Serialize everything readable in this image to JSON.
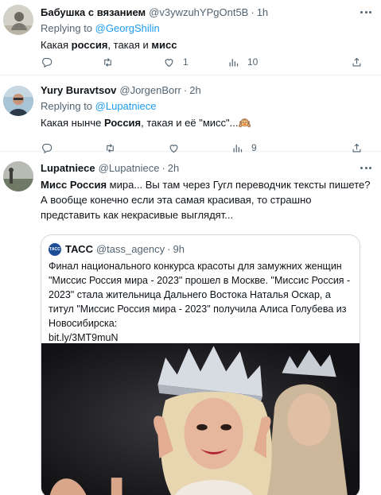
{
  "tweets": [
    {
      "name": "Бабушка с вязанием",
      "handle": "@v3ywzuhYPgOnt5B",
      "dot": "·",
      "time": "1h",
      "replying_prefix": "Replying to ",
      "replying_to": "@GeorgShilin",
      "text_parts": [
        "Какая ",
        "россия",
        ", такая и ",
        "мисс"
      ],
      "actions": {
        "reply": "",
        "retweet": "",
        "like": "1",
        "views": "10"
      }
    },
    {
      "name": "Yury Buravtsov",
      "handle": "@JorgenBorr",
      "dot": "·",
      "time": "2h",
      "replying_prefix": "Replying to ",
      "replying_to": "@Lupatniece",
      "text_parts": [
        "Какая нынче ",
        "Россия",
        ", такая и её \"мисс\"...",
        "🙉"
      ],
      "actions": {
        "reply": "",
        "retweet": "",
        "like": "",
        "views": "9"
      }
    },
    {
      "name": "Lupatniece",
      "handle": "@Lupatniece",
      "dot": "·",
      "time": "2h",
      "text_parts": [
        "Мисс Россия",
        " мира... Вы там через Гугл переводчик тексты пишете? А вообще конечно если эта самая красивая, то страшно представить как некрасивые выглядят..."
      ],
      "quote": {
        "logo_text": "ТАСС",
        "name": "ТАСС",
        "handle": "@tass_agency",
        "dot": "·",
        "time": "9h",
        "text": "Финал национального конкурса красоты для замужних женщин \"Миссис Россия мира - 2023\" прошел в Москве. \"Миссис Россия - 2023\" стала жительница Дальнего Востока Наталья Оскар, а титул \"Миссис Россия мира - 2023\" получила Алиса Голубева из Новосибирска:",
        "link": "bit.ly/3MT9muN"
      }
    }
  ],
  "icons": {
    "reply": "reply-icon",
    "retweet": "retweet-icon",
    "like": "like-icon",
    "views": "views-icon",
    "more": "more-icon"
  },
  "colors": {
    "link": "#1d9bf0",
    "secondary": "#536471",
    "text": "#0f1419",
    "border": "#eff3f4"
  }
}
